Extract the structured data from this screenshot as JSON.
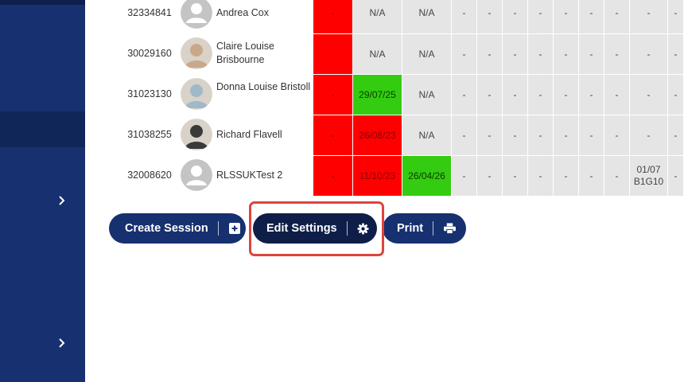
{
  "sidebar": {
    "chevron_icons": [
      "chevron-right-icon",
      "chevron-right-icon"
    ]
  },
  "rows": [
    {
      "id": "32334841",
      "name": "Andrea Cox",
      "avatar": "placeholder",
      "cells": [
        "-",
        "N/A",
        "N/A",
        "-",
        "-",
        "-",
        "-",
        "-",
        "-",
        "-",
        "-",
        "-"
      ],
      "status": [
        "red",
        "grey",
        "grey",
        "grey",
        "grey",
        "grey",
        "grey",
        "grey",
        "grey",
        "grey",
        "grey",
        "grey"
      ]
    },
    {
      "id": "30029160",
      "name": "Claire Louise Brisbourne",
      "avatar": "photo",
      "cells": [
        "",
        "N/A",
        "N/A",
        "-",
        "-",
        "-",
        "-",
        "-",
        "-",
        "-",
        "-",
        "-"
      ],
      "status": [
        "red",
        "grey",
        "grey",
        "grey",
        "grey",
        "grey",
        "grey",
        "grey",
        "grey",
        "grey",
        "grey",
        "grey"
      ]
    },
    {
      "id": "31023130",
      "name": "Donna Louise Bristoll",
      "avatar": "photo",
      "cells": [
        "-",
        "29/07/25",
        "N/A",
        "-",
        "-",
        "-",
        "-",
        "-",
        "-",
        "-",
        "-",
        "-"
      ],
      "status": [
        "red",
        "green",
        "grey",
        "grey",
        "grey",
        "grey",
        "grey",
        "grey",
        "grey",
        "grey",
        "grey",
        "grey"
      ]
    },
    {
      "id": "31038255",
      "name": "Richard Flavell",
      "avatar": "photo",
      "cells": [
        "-",
        "26/08/23",
        "N/A",
        "-",
        "-",
        "-",
        "-",
        "-",
        "-",
        "-",
        "-",
        "-"
      ],
      "status": [
        "red",
        "red",
        "grey",
        "grey",
        "grey",
        "grey",
        "grey",
        "grey",
        "grey",
        "grey",
        "grey",
        "grey"
      ]
    },
    {
      "id": "32008620",
      "name": "RLSSUKTest 2",
      "avatar": "placeholder",
      "cells": [
        "-",
        "11/10/23",
        "26/04/26",
        "-",
        "-",
        "-",
        "-",
        "-",
        "-",
        "-",
        "01/07 B1G10",
        "-"
      ],
      "status": [
        "red",
        "red",
        "green",
        "grey",
        "grey",
        "grey",
        "grey",
        "grey",
        "grey",
        "grey",
        "grey",
        "grey"
      ]
    }
  ],
  "actions": {
    "create_session": "Create Session",
    "create_session_icon": "plus-square-icon",
    "edit_settings": "Edit Settings",
    "edit_settings_icon": "gear-icon",
    "print": "Print",
    "print_icon": "printer-icon"
  },
  "colors": {
    "primary": "#17306f",
    "highlight": "#e0433d",
    "expired": "#fe0000",
    "valid": "#33cc11",
    "empty": "#e5e5e5"
  }
}
